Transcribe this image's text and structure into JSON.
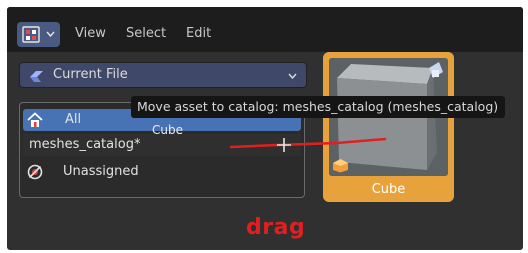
{
  "header": {
    "menu": [
      "View",
      "Select",
      "Edit"
    ]
  },
  "library_selector": {
    "value": "Current File"
  },
  "catalogs": [
    {
      "label": "All",
      "selected": true
    },
    {
      "label": "meshes_catalog*",
      "selected": false
    },
    {
      "label": "Unassigned",
      "selected": false
    }
  ],
  "asset": {
    "name": "Cube"
  },
  "tooltip": {
    "text": "Move asset to catalog: meshes_catalog (meshes_catalog)"
  },
  "drag_preview": {
    "label": "Cube"
  },
  "annotation": {
    "text": "drag",
    "color": "#e02020"
  },
  "colors": {
    "accent": "#4772b3",
    "asset_highlight": "#e8a23c"
  }
}
